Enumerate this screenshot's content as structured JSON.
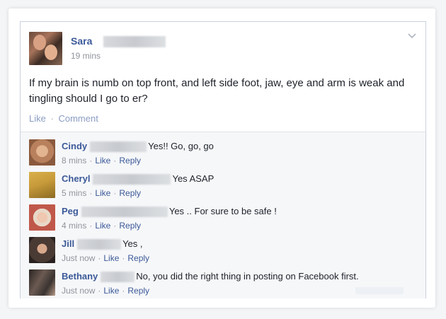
{
  "post": {
    "author": "Sara",
    "time": "19 mins",
    "text": "If my brain is numb on top front, and left side foot, jaw, eye and arm is weak and tingling should I go to er?",
    "actions": {
      "like": "Like",
      "comment": "Comment",
      "separator": "·"
    }
  },
  "comments": [
    {
      "name": "Cindy",
      "text": "Yes!! Go, go, go",
      "time": "8 mins",
      "like": "Like",
      "reply": "Reply",
      "avatar_color": "#b8805c"
    },
    {
      "name": "Cheryl",
      "text": "Yes ASAP",
      "time": "5 mins",
      "like": "Like",
      "reply": "Reply",
      "avatar_color": "#c79a3a"
    },
    {
      "name": "Peg",
      "text": "Yes .. For sure to be safe !",
      "time": "4 mins",
      "like": "Like",
      "reply": "Reply",
      "avatar_color": "#c0584a"
    },
    {
      "name": "Jill",
      "text": "Yes ,",
      "time": "Just now",
      "like": "Like",
      "reply": "Reply",
      "avatar_color": "#4a3a34"
    },
    {
      "name": "Bethany",
      "text": "No, you did the right thing in posting on Facebook first.",
      "time": "Just now",
      "like": "Like",
      "reply": "Reply",
      "avatar_color": "#3a3330"
    }
  ],
  "colors": {
    "link": "#3b5998",
    "muted": "#90949c",
    "text": "#1d2129",
    "comment_bg": "#f6f7f9"
  },
  "icons": {
    "menu": "chevron-down-icon"
  }
}
